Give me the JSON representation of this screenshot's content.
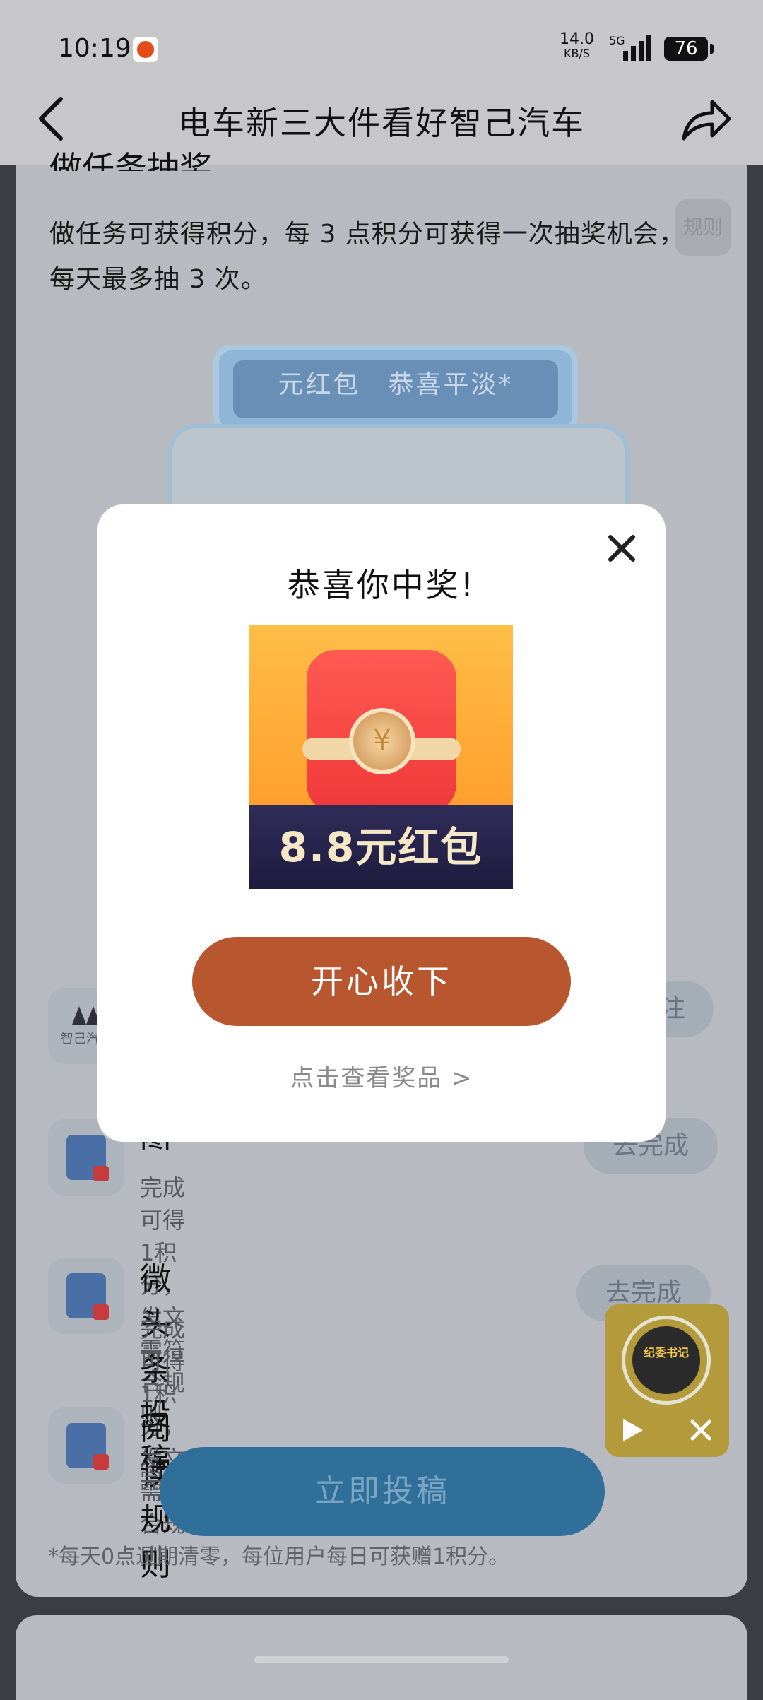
{
  "status": {
    "time": "10:19",
    "net_speed": "14.0",
    "net_unit": "KB/S",
    "signal_type": "5G",
    "battery": "76"
  },
  "nav": {
    "title": "电车新三大件看好智己汽车",
    "back_icon": "chevron-left-icon",
    "share_icon": "share-icon"
  },
  "page": {
    "section_title_partial": "做任务抽奖",
    "rules_text": "做任务可获得积分，每 3 点积分可获得一次抽奖机会，每天最多抽 3 次。",
    "rules_button": "规则",
    "machine_screen_text": "元红包　恭喜平淡*",
    "brand_logo_text": "智己汽",
    "follow_button_partial": "注",
    "tasks": [
      {
        "title": "图文投稿",
        "desc": "完成可得1积分，发文需符合规则",
        "button": "去完成"
      },
      {
        "title": "微头条投稿",
        "desc": "完成可得 1积分，发文需符合规则",
        "button": "去完成"
      },
      {
        "title": "阅读规则",
        "desc": "完",
        "button": ""
      }
    ],
    "submit_button": "立即投稿",
    "footnote": "*每天0点过期清零，每位用户每日可获赠1积分。"
  },
  "float_player": {
    "cover_title": "纪委书记"
  },
  "modal": {
    "title": "恭喜你中奖!",
    "prize_label": "8.8元红包",
    "currency_symbol": "¥",
    "accept_button": "开心收下",
    "view_prize_link": "点击查看奖品 >"
  },
  "colors": {
    "accent_button": "#b8562f",
    "submit_button": "#2f6f99",
    "dim_overlay": "#3a3d44"
  }
}
